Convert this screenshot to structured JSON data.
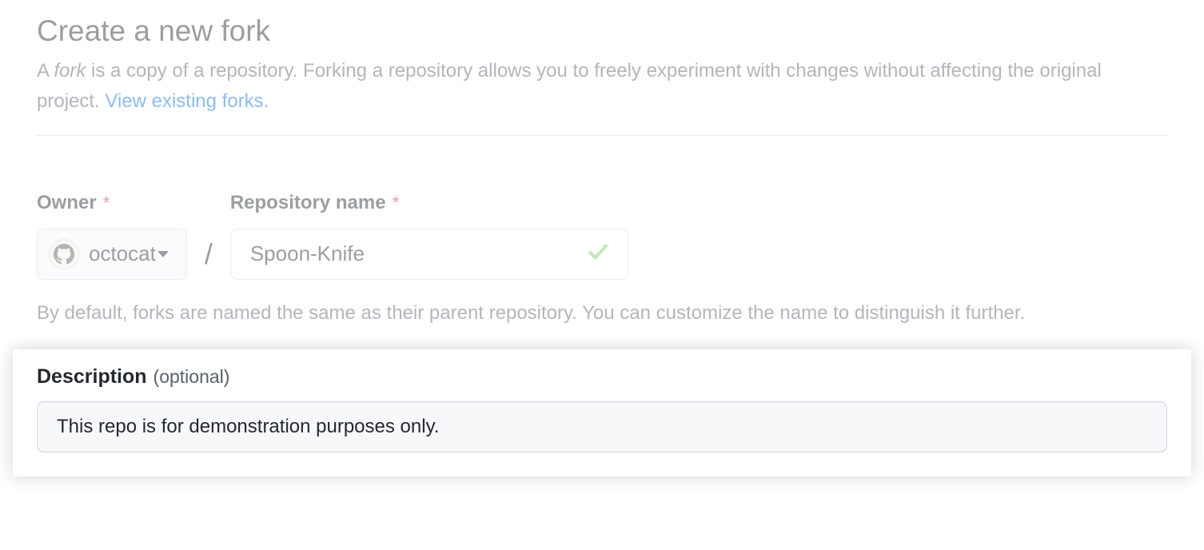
{
  "header": {
    "title": "Create a new fork",
    "subtitle_prefix": "A ",
    "subtitle_em": "fork",
    "subtitle_rest": " is a copy of a repository. Forking a repository allows you to freely experiment with changes without affecting the original project. ",
    "link_text": "View existing forks."
  },
  "form": {
    "owner_label": "Owner",
    "owner_value": "octocat",
    "slash": "/",
    "repo_label": "Repository name",
    "repo_value": "Spoon-Knife",
    "help_text": "By default, forks are named the same as their parent repository. You can customize the name to distinguish it further."
  },
  "description": {
    "label": "Description",
    "optional": "(optional)",
    "value": "This repo is for demonstration purposes only."
  }
}
